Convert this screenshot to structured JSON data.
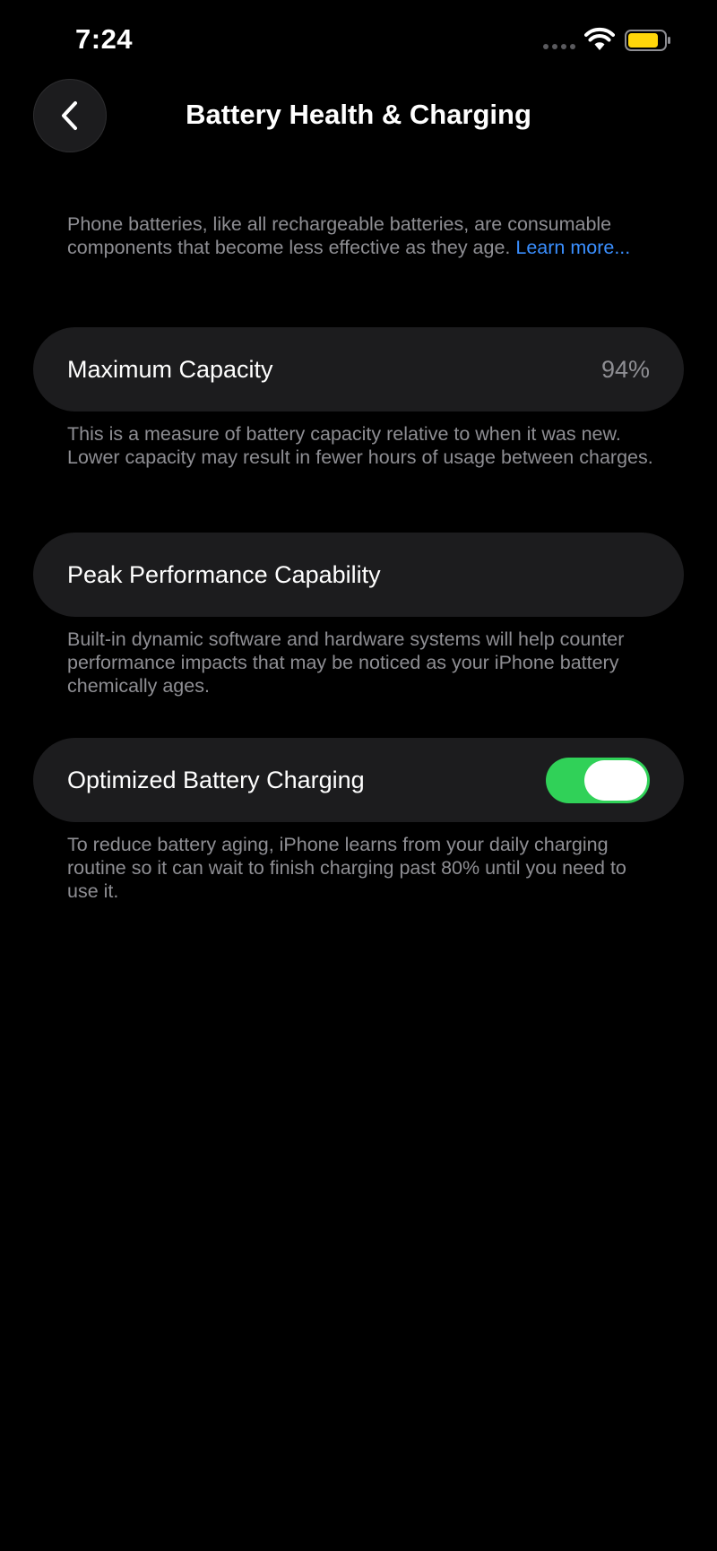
{
  "status_bar": {
    "time": "7:24",
    "battery_color": "#ffd60a"
  },
  "nav": {
    "back_icon": "chevron-left-icon",
    "title": "Battery Health & Charging"
  },
  "intro": {
    "text": "Phone batteries, like all rechargeable batteries, are consumable components that become less effective as they age. ",
    "link_label": "Learn more..."
  },
  "maximum_capacity": {
    "label": "Maximum Capacity",
    "value": "94%",
    "footnote": "This is a measure of battery capacity relative to when it was new. Lower capacity may result in fewer hours of usage between charges."
  },
  "peak_performance": {
    "label": "Peak Performance Capability",
    "footnote": "Built-in dynamic software and hardware systems will help counter performance impacts that may be noticed as your iPhone battery chemically ages."
  },
  "optimized_charging": {
    "label": "Optimized Battery Charging",
    "enabled": true,
    "toggle_color": "#30d158",
    "footnote": "To reduce battery aging, iPhone learns from your daily charging routine so it can wait to finish charging past 80% until you need to use it."
  }
}
